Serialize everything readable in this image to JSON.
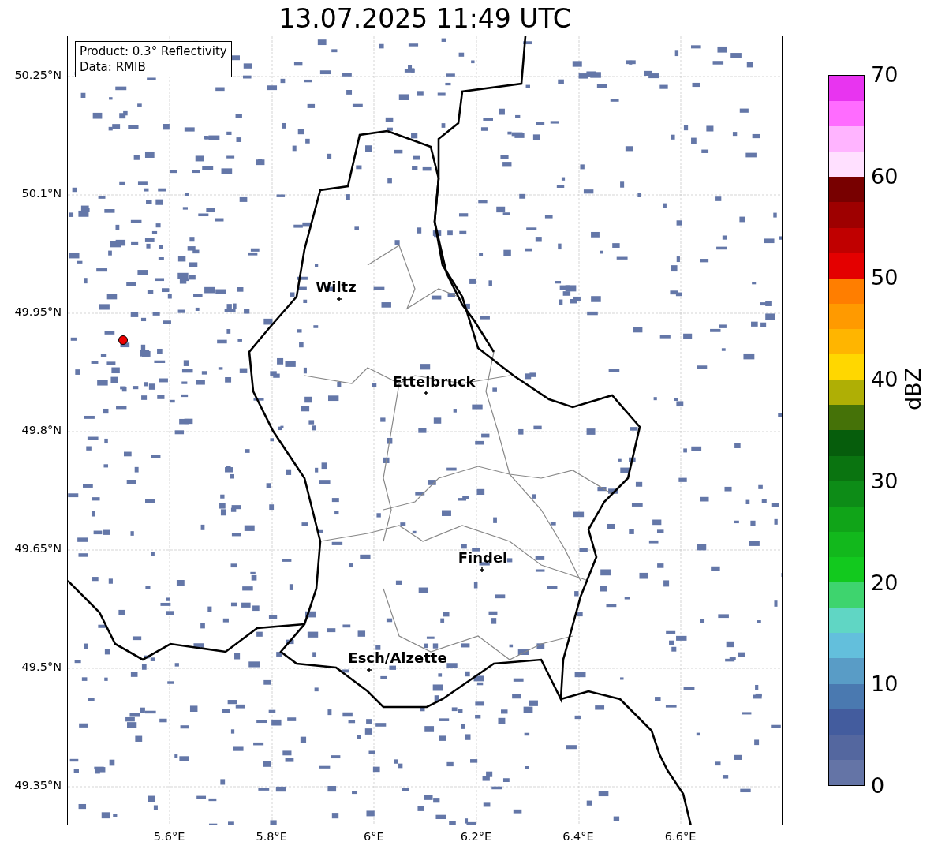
{
  "title": "13.07.2025 11:49 UTC",
  "info_box": [
    "Product: 0.3° Reflectivity",
    "Data: RMIB"
  ],
  "lat_ticks": [
    "50.25°N",
    "50.1°N",
    "49.95°N",
    "49.8°N",
    "49.65°N",
    "49.5°N",
    "49.35°N"
  ],
  "lon_ticks": [
    "5.6°E",
    "5.8°E",
    "6°E",
    "6.2°E",
    "6.4°E",
    "6.6°E"
  ],
  "cities": [
    {
      "name": "Wiltz"
    },
    {
      "name": "Ettelbruck"
    },
    {
      "name": "Findel"
    },
    {
      "name": "Esch/Alzette"
    }
  ],
  "colorbar": {
    "label": "dBZ",
    "ticks": [
      "70",
      "60",
      "50",
      "40",
      "30",
      "20",
      "10",
      "0"
    ],
    "segments": [
      {
        "color": "#6474a6"
      },
      {
        "color": "#54679f"
      },
      {
        "color": "#435c9e"
      },
      {
        "color": "#4a79b0"
      },
      {
        "color": "#599cc6"
      },
      {
        "color": "#63bfdc"
      },
      {
        "color": "#60d6c4"
      },
      {
        "color": "#3ed46e"
      },
      {
        "color": "#12c91e"
      },
      {
        "color": "#12b81c"
      },
      {
        "color": "#10a418"
      },
      {
        "color": "#0d8c17"
      },
      {
        "color": "#0a7410"
      },
      {
        "color": "#065d0c"
      },
      {
        "color": "#457208"
      },
      {
        "color": "#afaf05"
      },
      {
        "color": "#ffd700"
      },
      {
        "color": "#ffb500"
      },
      {
        "color": "#ff9a00"
      },
      {
        "color": "#ff7e00"
      },
      {
        "color": "#e40000"
      },
      {
        "color": "#c00000"
      },
      {
        "color": "#9e0000"
      },
      {
        "color": "#780000"
      },
      {
        "color": "#ffe0ff"
      },
      {
        "color": "#ffb4ff"
      },
      {
        "color": "#ff6cff"
      },
      {
        "color": "#e834f0"
      }
    ]
  }
}
